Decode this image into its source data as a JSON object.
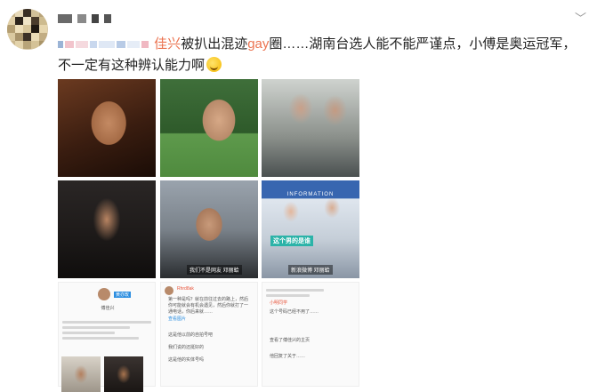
{
  "post": {
    "author_masked": true,
    "mention": "佳兴",
    "body_part1": "被扒出混迹",
    "body_keyword": "gay",
    "body_part2": "圈……湖南台选人能不能严谨点，小傅是奥运冠军，不一定有这种辨认能力啊",
    "emoji_icon": "laughing-emoji-icon",
    "link_color": "#eb7350"
  },
  "header": {
    "menu_icon": "chevron-down-icon",
    "menu_glyph": "﹀"
  },
  "images": {
    "p5_caption": "我们不是网友 邓丽蛤",
    "p6_caption": "新浪微博 邓丽蛤",
    "p6_tag": "这个男的是谁",
    "p6_sign": "INFORMATION",
    "s1_badge": "黄亦玫",
    "s1_name": "傅佳兴",
    "s2_name": "Rhrd8ak",
    "s2_text": "第一种是吗？就在前往过去的路上，然后你可能就会有机会遇见，然后你就打了一通电话，你后来就……",
    "s2_link": "查看图片",
    "s2_c1": "这是他以前的自拍号吧",
    "s2_c2": "我们说的还挺好的",
    "s2_c3": "这是他的实体号吗",
    "s3_name": "小明同学",
    "s3_text": "这个号码已经不用了……",
    "s3_c1": "查看了傅佳兴的主页",
    "s3_c2": "他回复了关于……"
  }
}
